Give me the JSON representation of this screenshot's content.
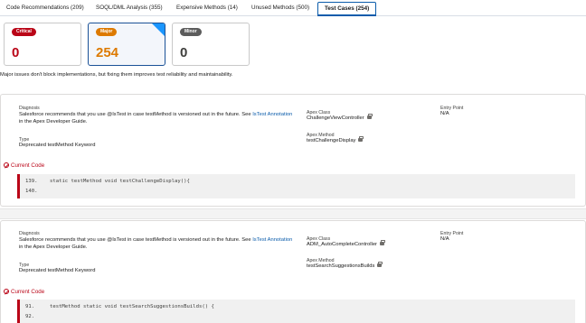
{
  "tabs": [
    {
      "label": "Code Recommendations (209)",
      "active": false
    },
    {
      "label": "SOQL/DML Analysis (355)",
      "active": false
    },
    {
      "label": "Expensive Methods (14)",
      "active": false
    },
    {
      "label": "Unused Methods (500)",
      "active": false
    },
    {
      "label": "Test Cases (254)",
      "active": true
    }
  ],
  "severity_cards": [
    {
      "badge": "Critical",
      "count": "0",
      "color": "#ba0517"
    },
    {
      "badge": "Major",
      "count": "254",
      "color": "#dd7a01",
      "selected": true
    },
    {
      "badge": "Minor",
      "count": "0",
      "color": "#5c5c5c"
    }
  ],
  "description": "Major issues don't block implementations, but fixing them improves test reliability and maintainability.",
  "labels": {
    "diagnosis": "Diagnosis",
    "type": "Type",
    "apex_class": "Apex Class",
    "apex_method": "Apex Method",
    "entry_point": "Entry Point",
    "current_code": "Current Code"
  },
  "issues": [
    {
      "diagnosis_prefix": "Salesforce recommends that you use @IsTest in case testMethod is versioned out in the future. See ",
      "diagnosis_link": "IsTest Annotation",
      "diagnosis_suffix": " in the Apex Developer Guide.",
      "type": "Deprecated testMethod Keyword",
      "apex_class": "ChallengeViewController",
      "apex_method": "testChallengeDisplay",
      "entry_point": "N/A",
      "code_lines": [
        {
          "num": "139.",
          "text": "static testMethod void testChallengeDisplay(){"
        },
        {
          "num": "140.",
          "text": ""
        }
      ]
    },
    {
      "diagnosis_prefix": "Salesforce recommends that you use @IsTest in case testMethod is versioned out in the future. See ",
      "diagnosis_link": "IsTest Annotation",
      "diagnosis_suffix": " in the Apex Developer Guide.",
      "type": "Deprecated testMethod Keyword",
      "apex_class": "ADM_AutoCompleteController",
      "apex_method": "testSearchSuggestionsBuilds",
      "entry_point": "N/A",
      "code_lines": [
        {
          "num": "91.",
          "text": "testMethod static void testSearchSuggestionsBuilds() {"
        },
        {
          "num": "92.",
          "text": ""
        }
      ]
    }
  ],
  "colors": {
    "accent": "#0b5cab",
    "critical": "#ba0517",
    "major": "#dd7a01",
    "minor": "#5c5c5c"
  }
}
